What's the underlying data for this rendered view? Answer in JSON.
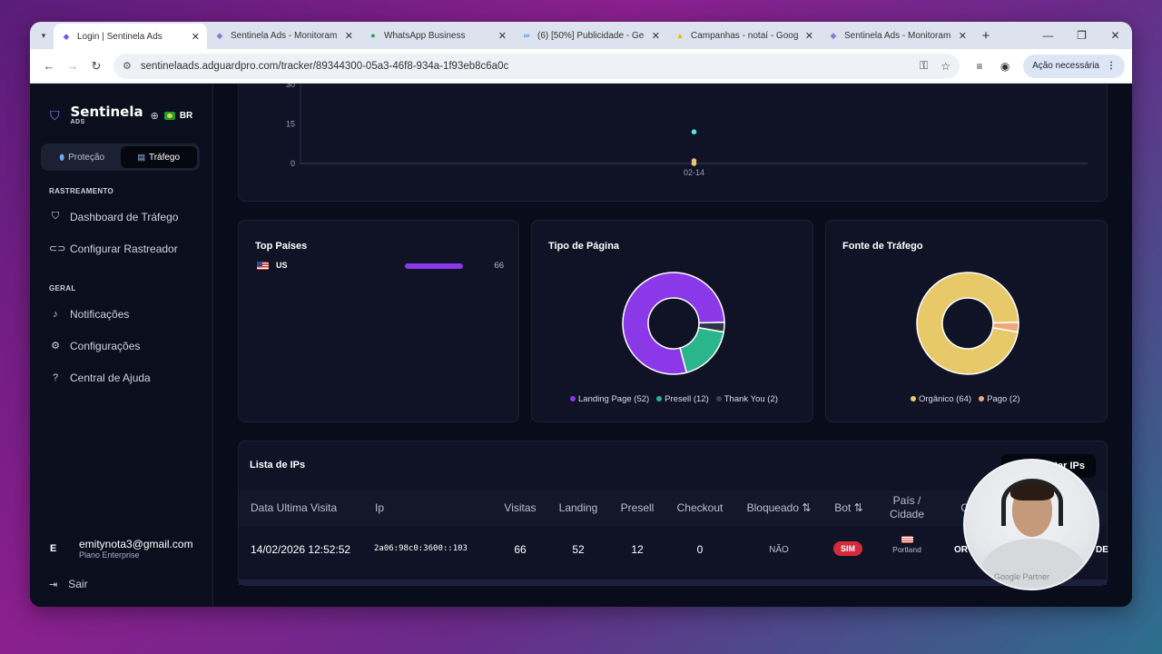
{
  "browser": {
    "tabs": [
      {
        "title": "Login | Sentinela Ads",
        "icon": "shield-icon",
        "active": true
      },
      {
        "title": "Sentinela Ads - Monitoram",
        "icon": "shield-icon",
        "active": false
      },
      {
        "title": "WhatsApp Business",
        "icon": "whatsapp-icon",
        "active": false
      },
      {
        "title": "(6) [50%] Publicidade - Ge",
        "icon": "meta-icon",
        "active": false
      },
      {
        "title": "Campanhas - notaí - Goog",
        "icon": "google-ads-icon",
        "active": false
      },
      {
        "title": "Sentinela Ads - Monitoram",
        "icon": "shield-icon",
        "active": false
      }
    ],
    "url": "sentinelaads.adguardpro.com/tracker/89344300-05a3-46f8-934a-1f93eb8c6a0c",
    "action_pill": "Ação necessária"
  },
  "sidebar": {
    "brand": "Sentinela",
    "brand_sub": "ADS",
    "lang": "BR",
    "modes": [
      "Proteção",
      "Tráfego"
    ],
    "section_tracking": "RASTREAMENTO",
    "tracking_items": [
      "Dashboard de Tráfego",
      "Configurar Rastreador"
    ],
    "section_general": "GERAL",
    "general_items": [
      "Notificações",
      "Configurações",
      "Central de Ajuda"
    ],
    "user_initial": "E",
    "user_email": "emitynota3@gmail.com",
    "user_plan": "Plano Enterprise",
    "logout": "Sair"
  },
  "timeline": {
    "y_ticks": [
      "30",
      "15",
      "0"
    ],
    "x_tick": "02-14"
  },
  "top_countries": {
    "title": "Top Países",
    "rows": [
      {
        "country": "US",
        "count": "66",
        "share": 1.0
      }
    ]
  },
  "page_type": {
    "title": "Tipo de Página",
    "legend": [
      "Landing Page (52)",
      "Presell (12)",
      "Thank You (2)"
    ]
  },
  "traffic_source": {
    "title": "Fonte de Tráfego",
    "legend": [
      "Orgânico (64)",
      "Pago (2)"
    ]
  },
  "ip_list": {
    "title": "Lista de IPs",
    "export_label": "Exportar IPs",
    "headers": {
      "last_visit": "Data Ultima Visita",
      "ip": "Ip",
      "visits": "Visitas",
      "landing": "Landing",
      "presell": "Presell",
      "checkout": "Checkout",
      "blocked": "Bloqueado ⇅",
      "bot": "Bot ⇅",
      "country_city": "País / Cidade",
      "origin": "O"
    },
    "row": {
      "last_visit": "14/02/2026 12:52:52",
      "ip": "2a06:98c0:3600::103",
      "visits": "66",
      "landing": "52",
      "presell": "12",
      "checkout": "0",
      "blocked": "NÃO",
      "bot": "SIM",
      "city": "Portland",
      "origin": "OR",
      "extra": "DE"
    }
  },
  "webcam_caption": "Google Partner",
  "chart_data": [
    {
      "type": "scatter",
      "title": "",
      "xlabel": "",
      "ylabel": "",
      "categories": [
        "02-14"
      ],
      "ylim": [
        0,
        30
      ],
      "series": [
        {
          "values": [
            12
          ],
          "color": "#5ee0e0"
        },
        {
          "values": [
            1
          ],
          "color": "#f2b38a"
        },
        {
          "values": [
            0
          ],
          "color": "#e7c86a"
        }
      ]
    },
    {
      "type": "pie",
      "title": "Tipo de Página",
      "categories": [
        "Landing Page",
        "Presell",
        "Thank You"
      ],
      "values": [
        52,
        12,
        2
      ],
      "colors": [
        "#8a38e8",
        "#2bb58c",
        "#2c3446"
      ]
    },
    {
      "type": "pie",
      "title": "Fonte de Tráfego",
      "categories": [
        "Orgânico",
        "Pago"
      ],
      "values": [
        64,
        2
      ],
      "colors": [
        "#e8c96a",
        "#f0a878"
      ]
    }
  ]
}
